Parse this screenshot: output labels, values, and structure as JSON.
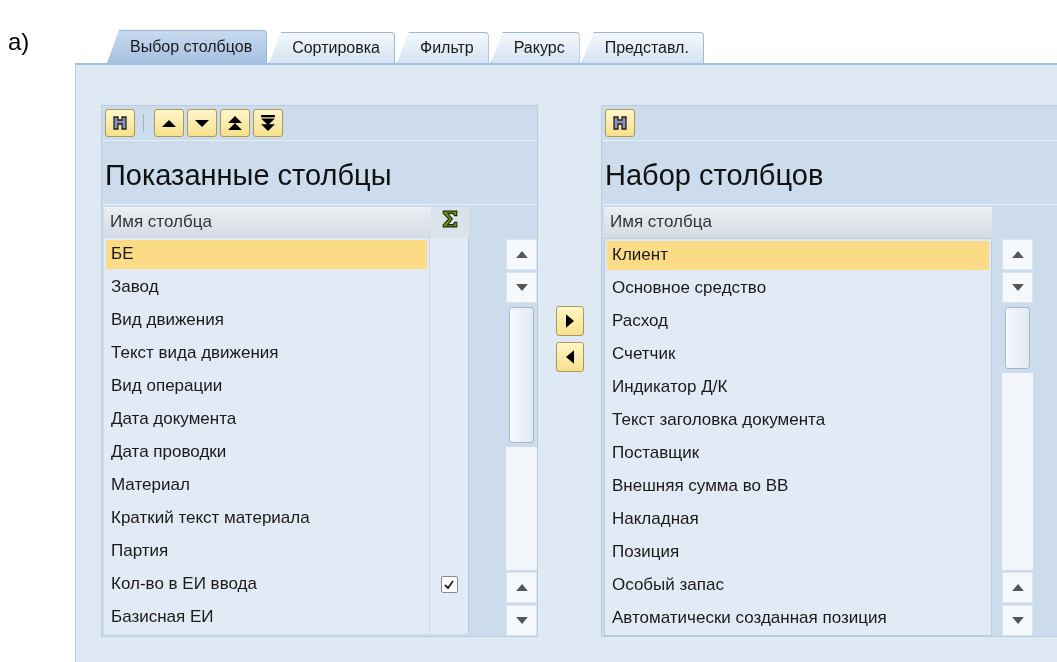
{
  "figure_label": "а)",
  "tabs": [
    {
      "label": "Выбор столбцов",
      "selected": true
    },
    {
      "label": "Сортировка",
      "selected": false
    },
    {
      "label": "Фильтр",
      "selected": false
    },
    {
      "label": "Ракурс",
      "selected": false
    },
    {
      "label": "Представл.",
      "selected": false
    }
  ],
  "shown_columns": {
    "title": "Показанные столбцы",
    "header": "Имя столбца",
    "rows": [
      {
        "name": "БЕ",
        "selected": true
      },
      {
        "name": "Завод",
        "selected": false
      },
      {
        "name": "Вид движения",
        "selected": false
      },
      {
        "name": "Текст вида движения",
        "selected": false
      },
      {
        "name": "Вид операции",
        "selected": false
      },
      {
        "name": "Дата документа",
        "selected": false
      },
      {
        "name": "Дата проводки",
        "selected": false
      },
      {
        "name": "Материал",
        "selected": false
      },
      {
        "name": "Краткий текст материала",
        "selected": false
      },
      {
        "name": "Партия",
        "selected": false
      },
      {
        "name": "Кол-во в ЕИ ввода",
        "selected": false,
        "total": {
          "checked": true
        }
      },
      {
        "name": "Базисная ЕИ",
        "selected": false
      }
    ]
  },
  "column_set": {
    "title": "Набор столбцов",
    "header": "Имя столбца",
    "rows": [
      {
        "name": "Клиент",
        "selected": true
      },
      {
        "name": "Основное средство",
        "selected": false
      },
      {
        "name": "Расход",
        "selected": false
      },
      {
        "name": "Счетчик",
        "selected": false
      },
      {
        "name": "Индикатор Д/К",
        "selected": false
      },
      {
        "name": "Текст заголовка документа",
        "selected": false
      },
      {
        "name": "Поставщик",
        "selected": false
      },
      {
        "name": "Внешняя сумма во ВВ",
        "selected": false
      },
      {
        "name": "Накладная",
        "selected": false
      },
      {
        "name": "Позиция",
        "selected": false
      },
      {
        "name": "Особый запас",
        "selected": false
      },
      {
        "name": "Автоматически созданная позиция",
        "selected": false
      }
    ]
  }
}
